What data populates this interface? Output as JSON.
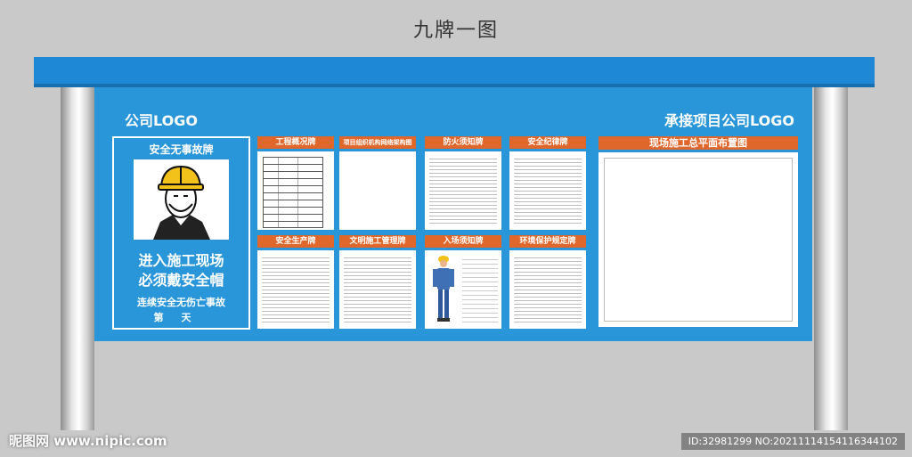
{
  "title": "九牌一图",
  "board": {
    "logo_left": "公司LOGO",
    "logo_right": "承接项目公司LOGO",
    "safety_sign": {
      "title": "安全无事故牌",
      "line1": "进入施工现场",
      "line2": "必须戴安全帽",
      "line3": "连续安全无伤亡事故",
      "line4": "第天"
    },
    "panels": [
      {
        "title": "工程概况牌"
      },
      {
        "title": "项目组织机构网络架构图"
      },
      {
        "title": "防火须知牌"
      },
      {
        "title": "安全纪律牌"
      },
      {
        "title": "安全生产牌"
      },
      {
        "title": "文明施工管理牌"
      },
      {
        "title": "入场须知牌"
      },
      {
        "title": "环境保护规定牌"
      }
    ],
    "site_plan": {
      "title": "现场施工总平面布置图"
    }
  },
  "watermark": {
    "left": "昵图网 www.nipic.com",
    "right": "ID:32981299 NO:20211114154116344102"
  },
  "colors": {
    "board": "#2a96da",
    "roof": "#1e88d6",
    "accent": "#e0672c"
  }
}
